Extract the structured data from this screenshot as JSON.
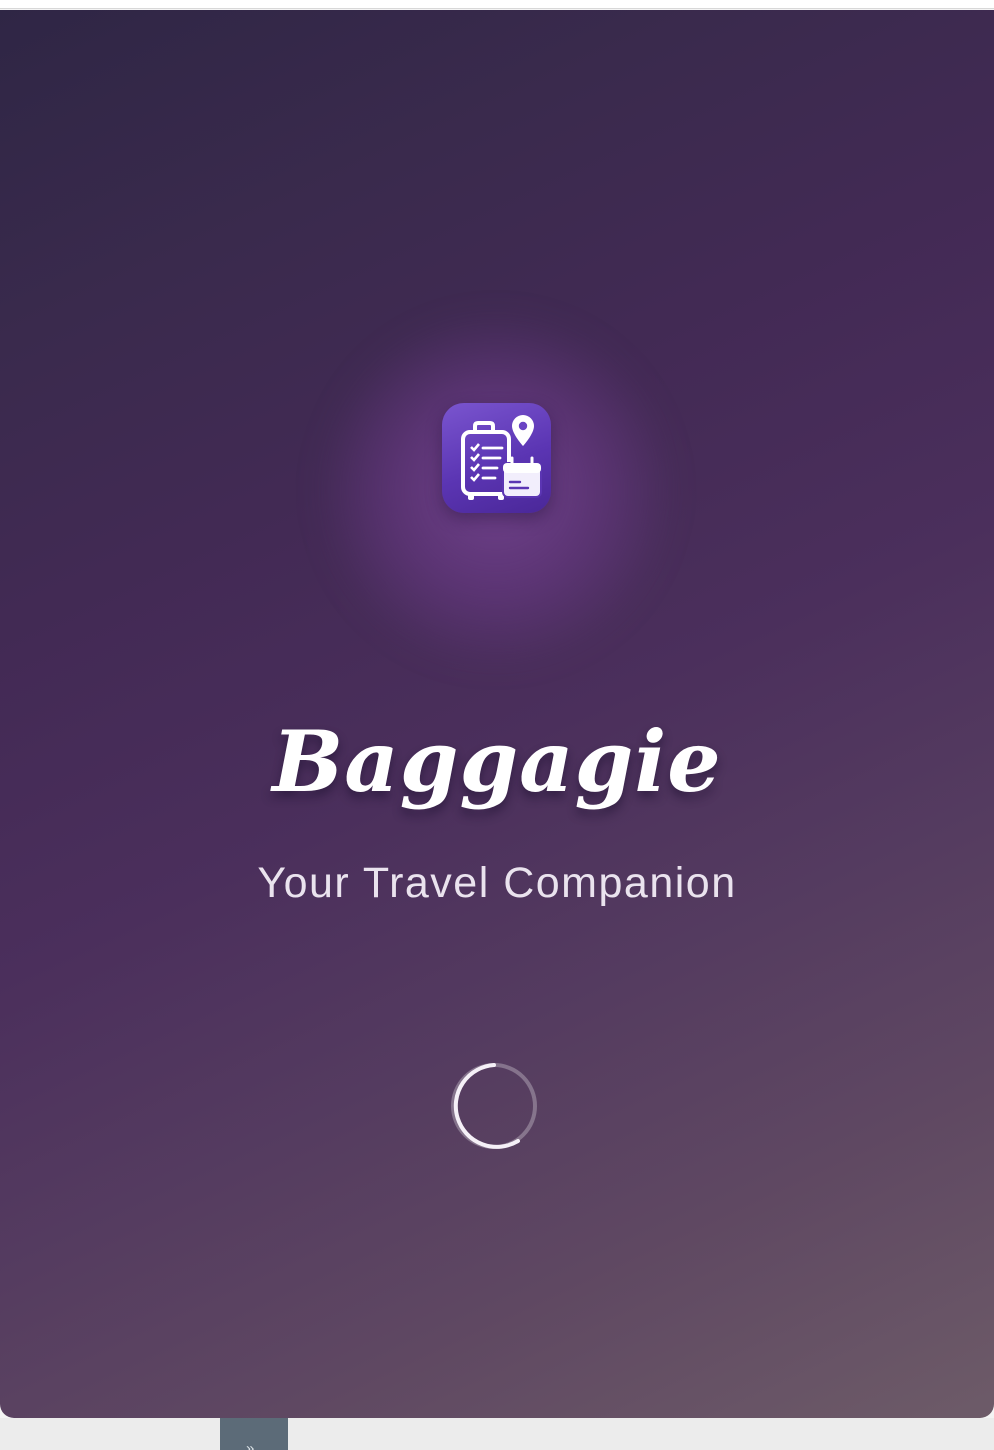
{
  "app": {
    "title": "Baggagie",
    "tagline": "Your Travel Companion",
    "icon": "luggage-checklist-calendar-pin-icon"
  },
  "status": {
    "loading": true,
    "indicator": "circular-progress-spinner"
  },
  "colors": {
    "background_start": "#2f2645",
    "background_end": "#6d5b68",
    "icon_tile": "#5b35b3",
    "title_text": "#ffffff",
    "tagline_text": "#eae3ee"
  }
}
